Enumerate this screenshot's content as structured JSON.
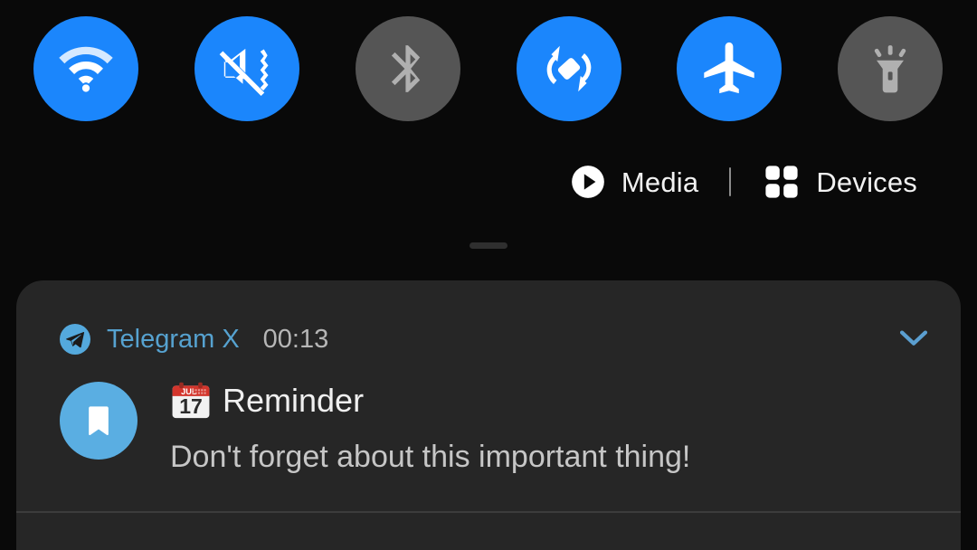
{
  "colors": {
    "background": "#090909",
    "tile_active": "#1b86fc",
    "tile_inactive": "#555555",
    "card_background": "#262626",
    "app_name_accent": "#56a2d0",
    "avatar_background": "#5aaee2"
  },
  "quick_settings": {
    "tiles": [
      {
        "name": "wifi",
        "icon": "wifi-icon",
        "state": "on",
        "label": "Wi-Fi"
      },
      {
        "name": "vibrate",
        "icon": "vibrate-icon",
        "state": "on",
        "label": "Vibrate"
      },
      {
        "name": "bluetooth",
        "icon": "bluetooth-icon",
        "state": "off",
        "label": "Bluetooth"
      },
      {
        "name": "auto-rotate",
        "icon": "auto-rotate-icon",
        "state": "on",
        "label": "Auto-rotate"
      },
      {
        "name": "airplane",
        "icon": "airplane-icon",
        "state": "on",
        "label": "Airplane mode"
      },
      {
        "name": "flashlight",
        "icon": "flashlight-icon",
        "state": "off",
        "label": "Flashlight"
      }
    ]
  },
  "shortcuts": {
    "media": {
      "label": "Media",
      "icon": "play-circle-icon"
    },
    "devices": {
      "label": "Devices",
      "icon": "grid-four-icon"
    },
    "separator": "|"
  },
  "drag_handle": {
    "name": "drag-handle"
  },
  "notification": {
    "app_name": "Telegram X",
    "time": "00:13",
    "app_icon": "telegram-plane-icon",
    "expand_icon": "chevron-down-icon",
    "avatar_icon": "bookmark-icon",
    "title_emoji": "calendar-emoji",
    "emoji_month": "JUL",
    "emoji_day": "17",
    "title": "Reminder",
    "message": "Don't forget about this important thing!"
  }
}
